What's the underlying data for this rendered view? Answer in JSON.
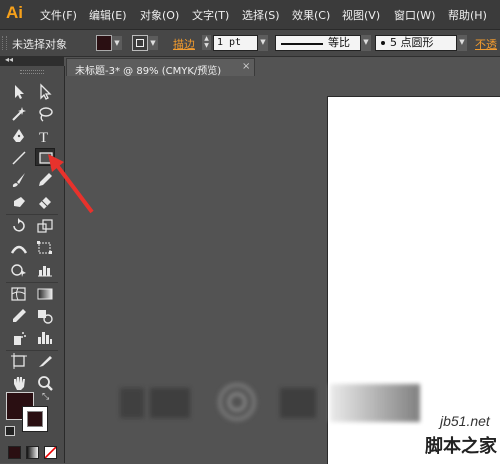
{
  "app": {
    "logo": "Ai"
  },
  "menu": [
    "文件(F)",
    "编辑(E)",
    "对象(O)",
    "文字(T)",
    "选择(S)",
    "效果(C)",
    "视图(V)",
    "窗口(W)",
    "帮助(H)"
  ],
  "control_bar": {
    "selection_status": "未选择对象",
    "fill_color": "#2a0f12",
    "stroke_label": "描边",
    "stroke_weight": "1 pt",
    "profile": "等比",
    "brush": "5 点圆形",
    "opacity_label": "不透"
  },
  "document": {
    "tab_title": "未标题-3* @ 89% (CMYK/预览)",
    "close_symbol": "×"
  },
  "tools": [
    "selection-tool",
    "direct-selection-tool",
    "magic-wand-tool",
    "lasso-tool",
    "pen-tool",
    "type-tool",
    "line-segment-tool",
    "rectangle-tool",
    "paintbrush-tool",
    "pencil-tool",
    "blob-brush-tool",
    "eraser-tool",
    "rotate-tool",
    "scale-tool",
    "width-tool",
    "free-transform-tool",
    "shape-builder-tool",
    "chart-tool",
    "mesh-tool",
    "gradient-tool",
    "eyedropper-tool",
    "blend-tool",
    "symbol-sprayer-tool",
    "column-graph-tool",
    "artboard-tool",
    "slice-tool",
    "hand-tool",
    "zoom-tool"
  ],
  "selected_tool": "rectangle-tool",
  "swatches": {
    "fill": "#2a0f12",
    "stroke": "#2a0f12"
  },
  "watermark": {
    "url": "jb51.net",
    "name": "脚本之家"
  },
  "accent_color": "#f29b2e",
  "arrow_color": "#e8322c"
}
